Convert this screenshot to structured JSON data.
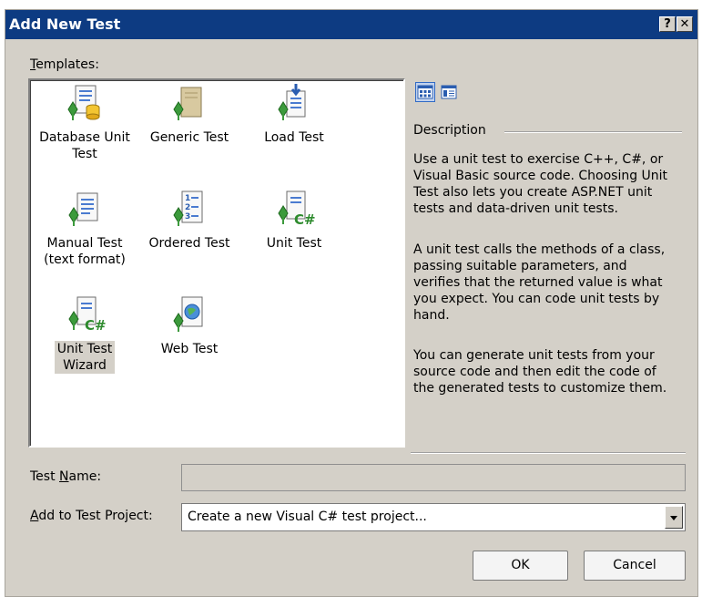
{
  "window": {
    "title": "Add New Test",
    "help_glyph": "?",
    "close_glyph": "✕"
  },
  "templates": {
    "label_prefix": "",
    "label_mnemonic": "T",
    "label_rest": "emplates:",
    "items": [
      {
        "line1": "Database Unit",
        "line2": "Test",
        "icon": "database-test-icon"
      },
      {
        "line1": "Generic Test",
        "line2": "",
        "icon": "generic-test-icon"
      },
      {
        "line1": "Load Test",
        "line2": "",
        "icon": "load-test-icon"
      },
      {
        "line1": "Manual Test",
        "line2": "(text format)",
        "icon": "manual-test-icon"
      },
      {
        "line1": "Ordered Test",
        "line2": "",
        "icon": "ordered-test-icon"
      },
      {
        "line1": "Unit Test",
        "line2": "",
        "icon": "unit-test-icon"
      },
      {
        "line1": "Unit Test",
        "line2": "Wizard",
        "icon": "unit-test-wizard-icon",
        "selected": true
      },
      {
        "line1": "Web Test",
        "line2": "",
        "icon": "web-test-icon"
      }
    ]
  },
  "description": {
    "heading": "Description",
    "paragraphs": [
      [
        "Use a unit test to exercise C++, C#, or",
        "Visual Basic source code. Choosing Unit",
        "Test also lets you create ASP.NET unit",
        "tests and data-driven unit tests."
      ],
      [
        "A unit test calls the methods of a class,",
        "passing suitable parameters, and",
        "verifies that the returned value is what",
        "you expect. You can code unit tests by",
        "hand."
      ],
      [
        "You can generate unit tests from your",
        "source code and then edit the code of",
        "the generated tests to customize them."
      ]
    ]
  },
  "form": {
    "test_name": {
      "prefix": "Test ",
      "mnemonic": "N",
      "rest": "ame:",
      "value": ""
    },
    "project": {
      "prefix": "",
      "mnemonic": "A",
      "rest": "dd to Test Project:",
      "value": "Create a new Visual C# test project..."
    }
  },
  "buttons": {
    "ok": "OK",
    "cancel": "Cancel"
  },
  "colors": {
    "titlebar": "#0d3b82",
    "dialog_bg": "#d4d0c8",
    "accent_green": "#3c9a3c",
    "page_blue": "#3a6fc4"
  }
}
